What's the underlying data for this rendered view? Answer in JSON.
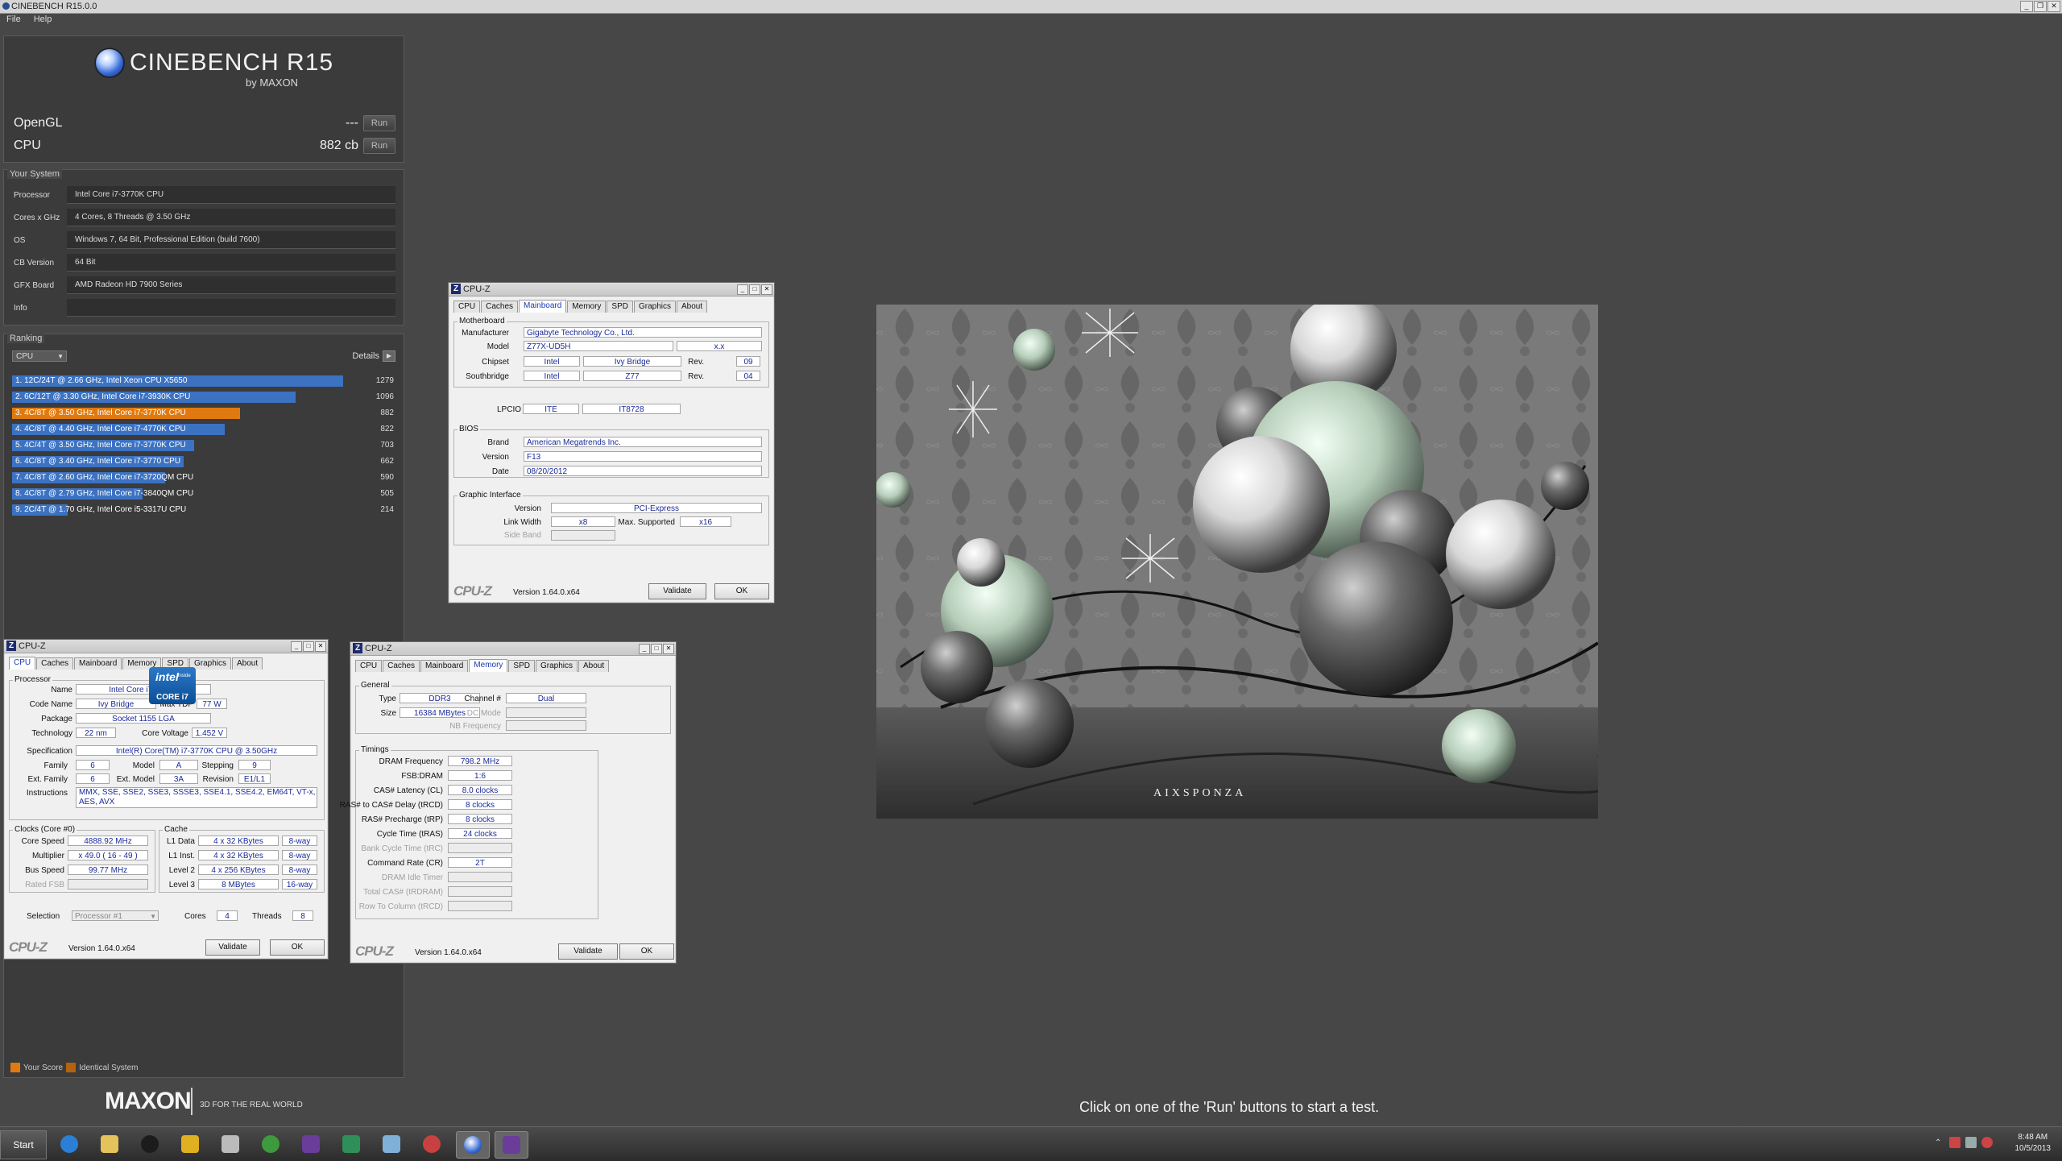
{
  "window": {
    "title": "CINEBENCH R15.0.0"
  },
  "menu": [
    "File",
    "Help"
  ],
  "header": {
    "product": "CINEBENCH R15",
    "byline": "by MAXON"
  },
  "benchmarks": [
    {
      "label": "OpenGL",
      "value": "---",
      "button": "Run"
    },
    {
      "label": "CPU",
      "value": "882 cb",
      "button": "Run"
    }
  ],
  "your_system": {
    "title": "Your System",
    "rows": [
      {
        "k": "Processor",
        "v": "Intel Core i7-3770K CPU"
      },
      {
        "k": "Cores x GHz",
        "v": "4 Cores, 8 Threads @ 3.50 GHz"
      },
      {
        "k": "OS",
        "v": "Windows 7, 64 Bit, Professional Edition (build 7600)"
      },
      {
        "k": "CB Version",
        "v": "64 Bit"
      },
      {
        "k": "GFX Board",
        "v": "AMD Radeon HD 7900 Series"
      },
      {
        "k": "Info",
        "v": ""
      }
    ]
  },
  "ranking": {
    "title": "Ranking",
    "selector": "CPU",
    "details_label": "Details",
    "rows": [
      {
        "text": "1. 12C/24T @ 2.66 GHz, Intel Xeon CPU X5650",
        "score": 1279,
        "type": "other"
      },
      {
        "text": "2. 6C/12T @ 3.30 GHz,  Intel Core i7-3930K CPU",
        "score": 1096,
        "type": "other"
      },
      {
        "text": "3. 4C/8T @ 3.50 GHz,  Intel Core i7-3770K CPU",
        "score": 882,
        "type": "yours"
      },
      {
        "text": "4. 4C/8T @ 4.40 GHz, Intel Core i7-4770K CPU",
        "score": 822,
        "type": "other"
      },
      {
        "text": "5. 4C/4T @ 3.50 GHz,  Intel Core i7-3770K CPU",
        "score": 703,
        "type": "other"
      },
      {
        "text": "6. 4C/8T @ 3.40 GHz,  Intel Core i7-3770 CPU",
        "score": 662,
        "type": "other"
      },
      {
        "text": "7. 4C/8T @ 2.60 GHz, Intel Core i7-3720QM CPU",
        "score": 590,
        "type": "other"
      },
      {
        "text": "8. 4C/8T @ 2.79 GHz,  Intel Core i7-3840QM CPU",
        "score": 505,
        "type": "other"
      },
      {
        "text": "9. 2C/4T @ 1.70 GHz,  Intel Core i5-3317U CPU",
        "score": 214,
        "type": "other"
      }
    ],
    "legend": {
      "yours": "Your Score",
      "identical": "Identical System"
    },
    "colors": {
      "other": "#3c72c2",
      "yours": "#e07a10",
      "identical": "#b5620e"
    }
  },
  "footer": {
    "brand": "MAXON",
    "tagline": "3D FOR THE REAL WORLD",
    "status": "Click on one of the 'Run' buttons to start a test."
  },
  "render": {
    "watermark": "AIXSPONZA"
  },
  "cpuz_mainboard": {
    "title": "CPU-Z",
    "tabs": [
      "CPU",
      "Caches",
      "Mainboard",
      "Memory",
      "SPD",
      "Graphics",
      "About"
    ],
    "active_tab": "Mainboard",
    "motherboard": {
      "title": "Motherboard",
      "manufacturer_label": "Manufacturer",
      "manufacturer": "Gigabyte Technology Co., Ltd.",
      "model_label": "Model",
      "model": "Z77X-UD5H",
      "model_rev": "x.x",
      "chipset_label": "Chipset",
      "chipset_vendor": "Intel",
      "chipset": "Ivy Bridge",
      "rev_label": "Rev.",
      "chipset_rev": "09",
      "southbridge_label": "Southbridge",
      "sb_vendor": "Intel",
      "southbridge": "Z77",
      "sb_rev": "04",
      "lpcio_label": "LPCIO",
      "lpcio_vendor": "ITE",
      "lpcio": "IT8728"
    },
    "bios": {
      "title": "BIOS",
      "brand_label": "Brand",
      "brand": "American Megatrends Inc.",
      "version_label": "Version",
      "version": "F13",
      "date_label": "Date",
      "date": "08/20/2012"
    },
    "graphic": {
      "title": "Graphic Interface",
      "version_label": "Version",
      "version": "PCI-Express",
      "link_label": "Link Width",
      "link": "x8",
      "max_label": "Max. Supported",
      "max": "x16",
      "sideband_label": "Side Band"
    },
    "footer": {
      "brand": "CPU-Z",
      "version": "Version 1.64.0.x64",
      "validate": "Validate",
      "ok": "OK"
    }
  },
  "cpuz_cpu": {
    "title": "CPU-Z",
    "tabs": [
      "CPU",
      "Caches",
      "Mainboard",
      "Memory",
      "SPD",
      "Graphics",
      "About"
    ],
    "active_tab": "CPU",
    "processor_title": "Processor",
    "name_label": "Name",
    "name": "Intel Core i7 3770K",
    "codename_label": "Code Name",
    "codename": "Ivy Bridge",
    "tdp_label": "Max TDP",
    "tdp": "77 W",
    "package_label": "Package",
    "package": "Socket 1155 LGA",
    "tech_label": "Technology",
    "tech": "22 nm",
    "voltage_label": "Core Voltage",
    "voltage": "1.452 V",
    "spec_label": "Specification",
    "spec": "Intel(R) Core(TM) i7-3770K CPU @ 3.50GHz",
    "family_label": "Family",
    "family": "6",
    "model_label": "Model",
    "model": "A",
    "stepping_label": "Stepping",
    "stepping": "9",
    "extfam_label": "Ext. Family",
    "extfam": "6",
    "extmodel_label": "Ext. Model",
    "extmodel": "3A",
    "revision_label": "Revision",
    "revision": "E1/L1",
    "instr_label": "Instructions",
    "instr": "MMX, SSE, SSE2, SSE3, SSSE3, SSE4.1, SSE4.2, EM64T, VT-x, AES, AVX",
    "clocks_title": "Clocks (Core #0)",
    "corespeed_label": "Core Speed",
    "corespeed": "4888.92 MHz",
    "mult_label": "Multiplier",
    "mult": "x 49.0 ( 16 - 49 )",
    "bus_label": "Bus Speed",
    "bus": "99.77 MHz",
    "fsb_label": "Rated FSB",
    "cache_title": "Cache",
    "l1d_label": "L1 Data",
    "l1d": "4 x 32 KBytes",
    "l1d_way": "8-way",
    "l1i_label": "L1 Inst.",
    "l1i": "4 x 32 KBytes",
    "l1i_way": "8-way",
    "l2_label": "Level 2",
    "l2": "4 x 256 KBytes",
    "l2_way": "8-way",
    "l3_label": "Level 3",
    "l3": "8 MBytes",
    "l3_way": "16-way",
    "selection_label": "Selection",
    "selection": "Processor #1",
    "cores_label": "Cores",
    "cores": "4",
    "threads_label": "Threads",
    "threads": "8",
    "intel_logo": {
      "brand": "intel",
      "inside": "inside",
      "line": "CORE i7"
    },
    "footer": {
      "brand": "CPU-Z",
      "version": "Version 1.64.0.x64",
      "validate": "Validate",
      "ok": "OK"
    }
  },
  "cpuz_memory": {
    "title": "CPU-Z",
    "tabs": [
      "CPU",
      "Caches",
      "Mainboard",
      "Memory",
      "SPD",
      "Graphics",
      "About"
    ],
    "active_tab": "Memory",
    "general_title": "General",
    "type_label": "Type",
    "type": "DDR3",
    "channel_label": "Channel #",
    "channel": "Dual",
    "size_label": "Size",
    "size": "16384 MBytes",
    "dcmode_label": "DC Mode",
    "nbfreq_label": "NB Frequency",
    "timings_title": "Timings",
    "timings": [
      {
        "k": "DRAM Frequency",
        "v": "798.2 MHz",
        "dim": false
      },
      {
        "k": "FSB:DRAM",
        "v": "1:6",
        "dim": false
      },
      {
        "k": "CAS# Latency (CL)",
        "v": "8.0 clocks",
        "dim": false
      },
      {
        "k": "RAS# to CAS# Delay (tRCD)",
        "v": "8 clocks",
        "dim": false
      },
      {
        "k": "RAS# Precharge (tRP)",
        "v": "8 clocks",
        "dim": false
      },
      {
        "k": "Cycle Time (tRAS)",
        "v": "24 clocks",
        "dim": false
      },
      {
        "k": "Bank Cycle Time (tRC)",
        "v": "",
        "dim": true
      },
      {
        "k": "Command Rate (CR)",
        "v": "2T",
        "dim": false
      },
      {
        "k": "DRAM Idle Timer",
        "v": "",
        "dim": true
      },
      {
        "k": "Total CAS# (tRDRAM)",
        "v": "",
        "dim": true
      },
      {
        "k": "Row To Column (tRCD)",
        "v": "",
        "dim": true
      }
    ],
    "footer": {
      "brand": "CPU-Z",
      "version": "Version 1.64.0.x64",
      "validate": "Validate",
      "ok": "OK"
    }
  },
  "taskbar": {
    "start": "Start",
    "time": "8:48 AM",
    "date": "10/5/2013"
  }
}
